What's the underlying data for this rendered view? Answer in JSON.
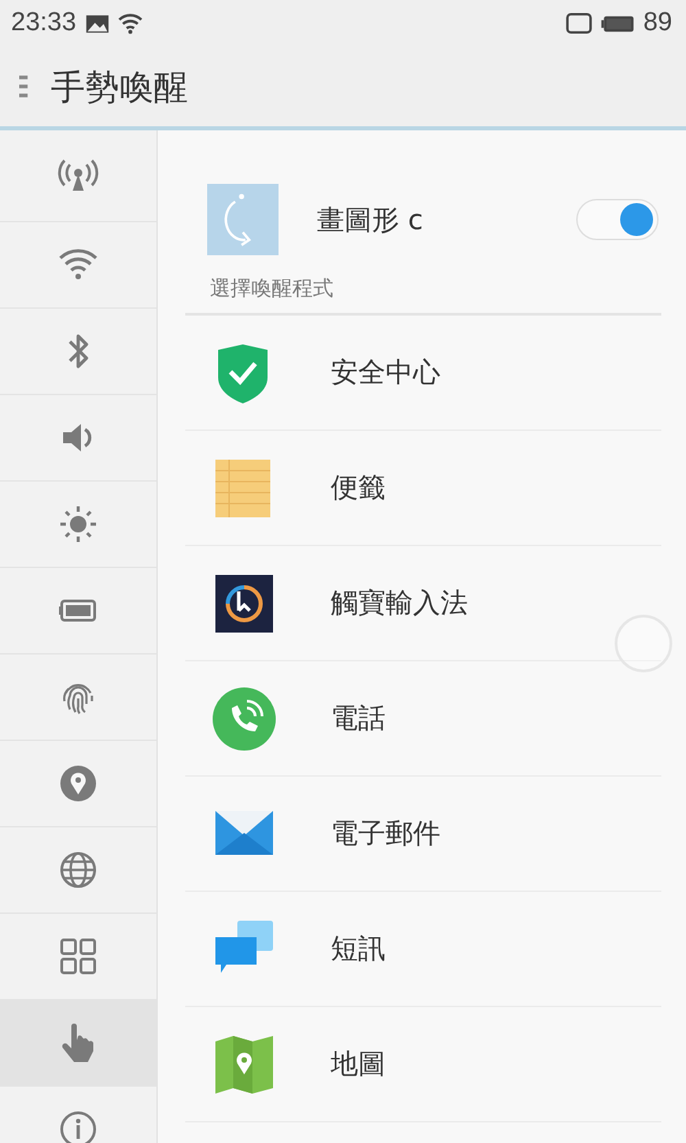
{
  "status_bar": {
    "time": "23:33",
    "battery": "89"
  },
  "header": {
    "title": "手勢喚醒"
  },
  "sidebar": {
    "items": [
      {
        "selected": false
      },
      {
        "selected": false
      },
      {
        "selected": false
      },
      {
        "selected": false
      },
      {
        "selected": false
      },
      {
        "selected": false
      },
      {
        "selected": false
      },
      {
        "selected": false
      },
      {
        "selected": false
      },
      {
        "selected": false
      },
      {
        "selected": true
      },
      {
        "selected": false
      }
    ]
  },
  "gesture": {
    "label": "畫圖形 c",
    "on": true
  },
  "section_label": "選擇喚醒程式",
  "apps": [
    {
      "label": "安全中心"
    },
    {
      "label": "便籤"
    },
    {
      "label": "觸寶輸入法"
    },
    {
      "label": "電話"
    },
    {
      "label": "電子郵件"
    },
    {
      "label": "短訊"
    },
    {
      "label": "地圖"
    }
  ]
}
